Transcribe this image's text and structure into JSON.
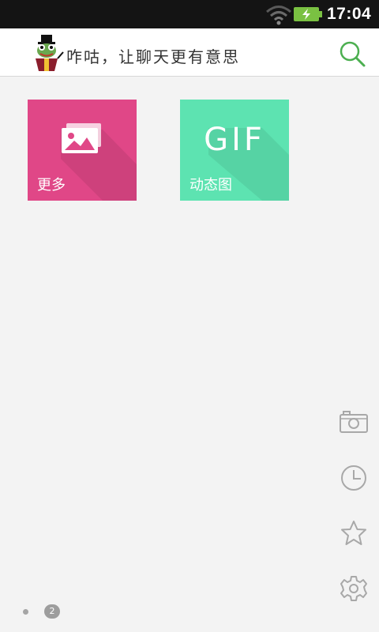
{
  "status_bar": {
    "time": "17:04",
    "icons": [
      "wifi-icon",
      "battery-charging-icon"
    ]
  },
  "header": {
    "slogan": "咋咕，让聊天更有意思",
    "logo_icon": "frog-magician-logo",
    "search_icon": "search-icon",
    "accent_color": "#4caf50"
  },
  "tiles": [
    {
      "label": "更多",
      "icon": "images-icon",
      "color": "#e04787"
    },
    {
      "label": "动态图",
      "icon_text": "GIF",
      "color": "#5de3b1"
    }
  ],
  "side_actions": [
    {
      "icon": "camera-icon"
    },
    {
      "icon": "clock-icon"
    },
    {
      "icon": "star-icon"
    },
    {
      "icon": "gear-icon"
    }
  ],
  "pager": {
    "page_number": "2"
  }
}
